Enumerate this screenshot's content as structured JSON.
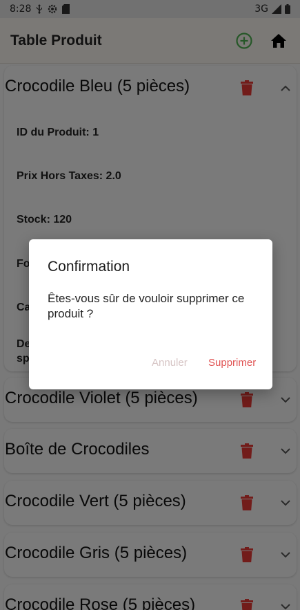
{
  "status_bar": {
    "time": "8:28",
    "network": "3G",
    "icons": [
      "usb-icon",
      "settings-gear-icon",
      "sd-card-icon",
      "signal-icon",
      "battery-icon"
    ]
  },
  "app_bar": {
    "title": "Table Produit",
    "add_icon": "add-circle-icon",
    "home_icon": "home-icon"
  },
  "colors": {
    "accent_green": "#4caf50",
    "danger_red": "#e53935",
    "confirm_text": "#e05353",
    "cancel_text": "#d6c4c4"
  },
  "products": [
    {
      "title": "Crocodile Bleu (5 pièces)",
      "expanded": true,
      "details": [
        "ID du Produit: 1",
        "Prix Hors Taxes: 2.0",
        "Stock: 120",
        "Fo",
        "Ca",
        "De\nsp"
      ]
    },
    {
      "title": "Crocodile Violet (5 pièces)",
      "expanded": false
    },
    {
      "title": "Boîte de Crocodiles",
      "expanded": false
    },
    {
      "title": "Crocodile Vert (5 pièces)",
      "expanded": false
    },
    {
      "title": "Crocodile Gris (5 pièces)",
      "expanded": false
    },
    {
      "title": "Crocodile Rose (5 pièces)",
      "expanded": false
    }
  ],
  "dialog": {
    "title": "Confirmation",
    "message": "Êtes-vous sûr de vouloir supprimer ce produit ?",
    "cancel_label": "Annuler",
    "confirm_label": "Supprimer"
  }
}
